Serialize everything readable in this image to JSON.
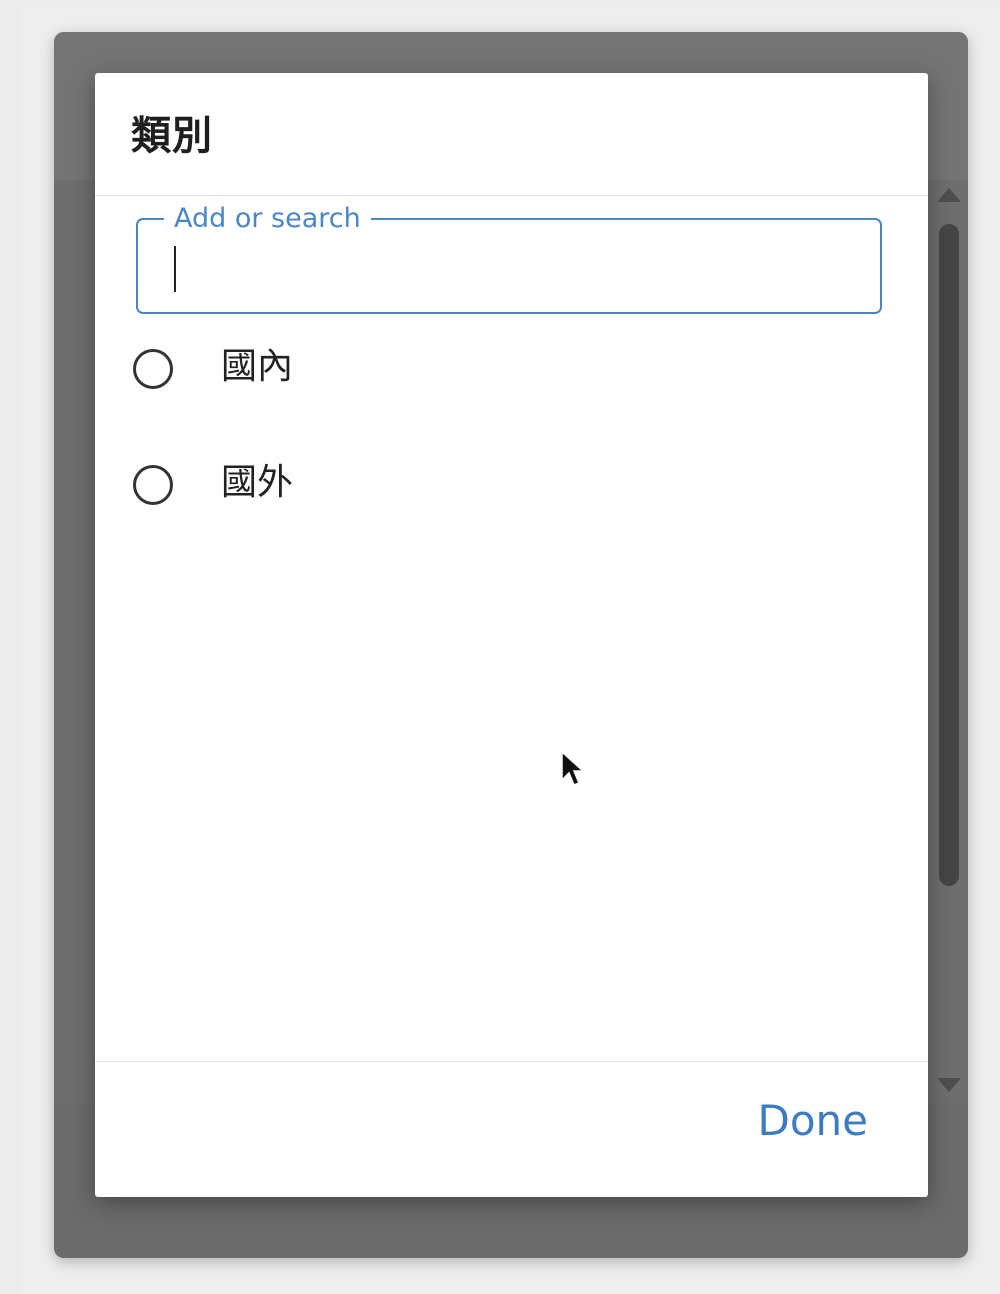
{
  "dialog": {
    "title": "類別",
    "search": {
      "label": "Add or search",
      "value": "",
      "placeholder": ""
    },
    "options": [
      {
        "label": "國內",
        "selected": false
      },
      {
        "label": "國外",
        "selected": false
      }
    ],
    "done_label": "Done"
  },
  "colors": {
    "accent": "#4a86c8",
    "done_text": "#3d7bc4",
    "backdrop": "#6e6e6e"
  },
  "icons": {
    "cursor": "arrow-pointer-icon",
    "scroll_up": "scroll-up-arrow-icon",
    "scroll_down": "scroll-down-arrow-icon"
  }
}
